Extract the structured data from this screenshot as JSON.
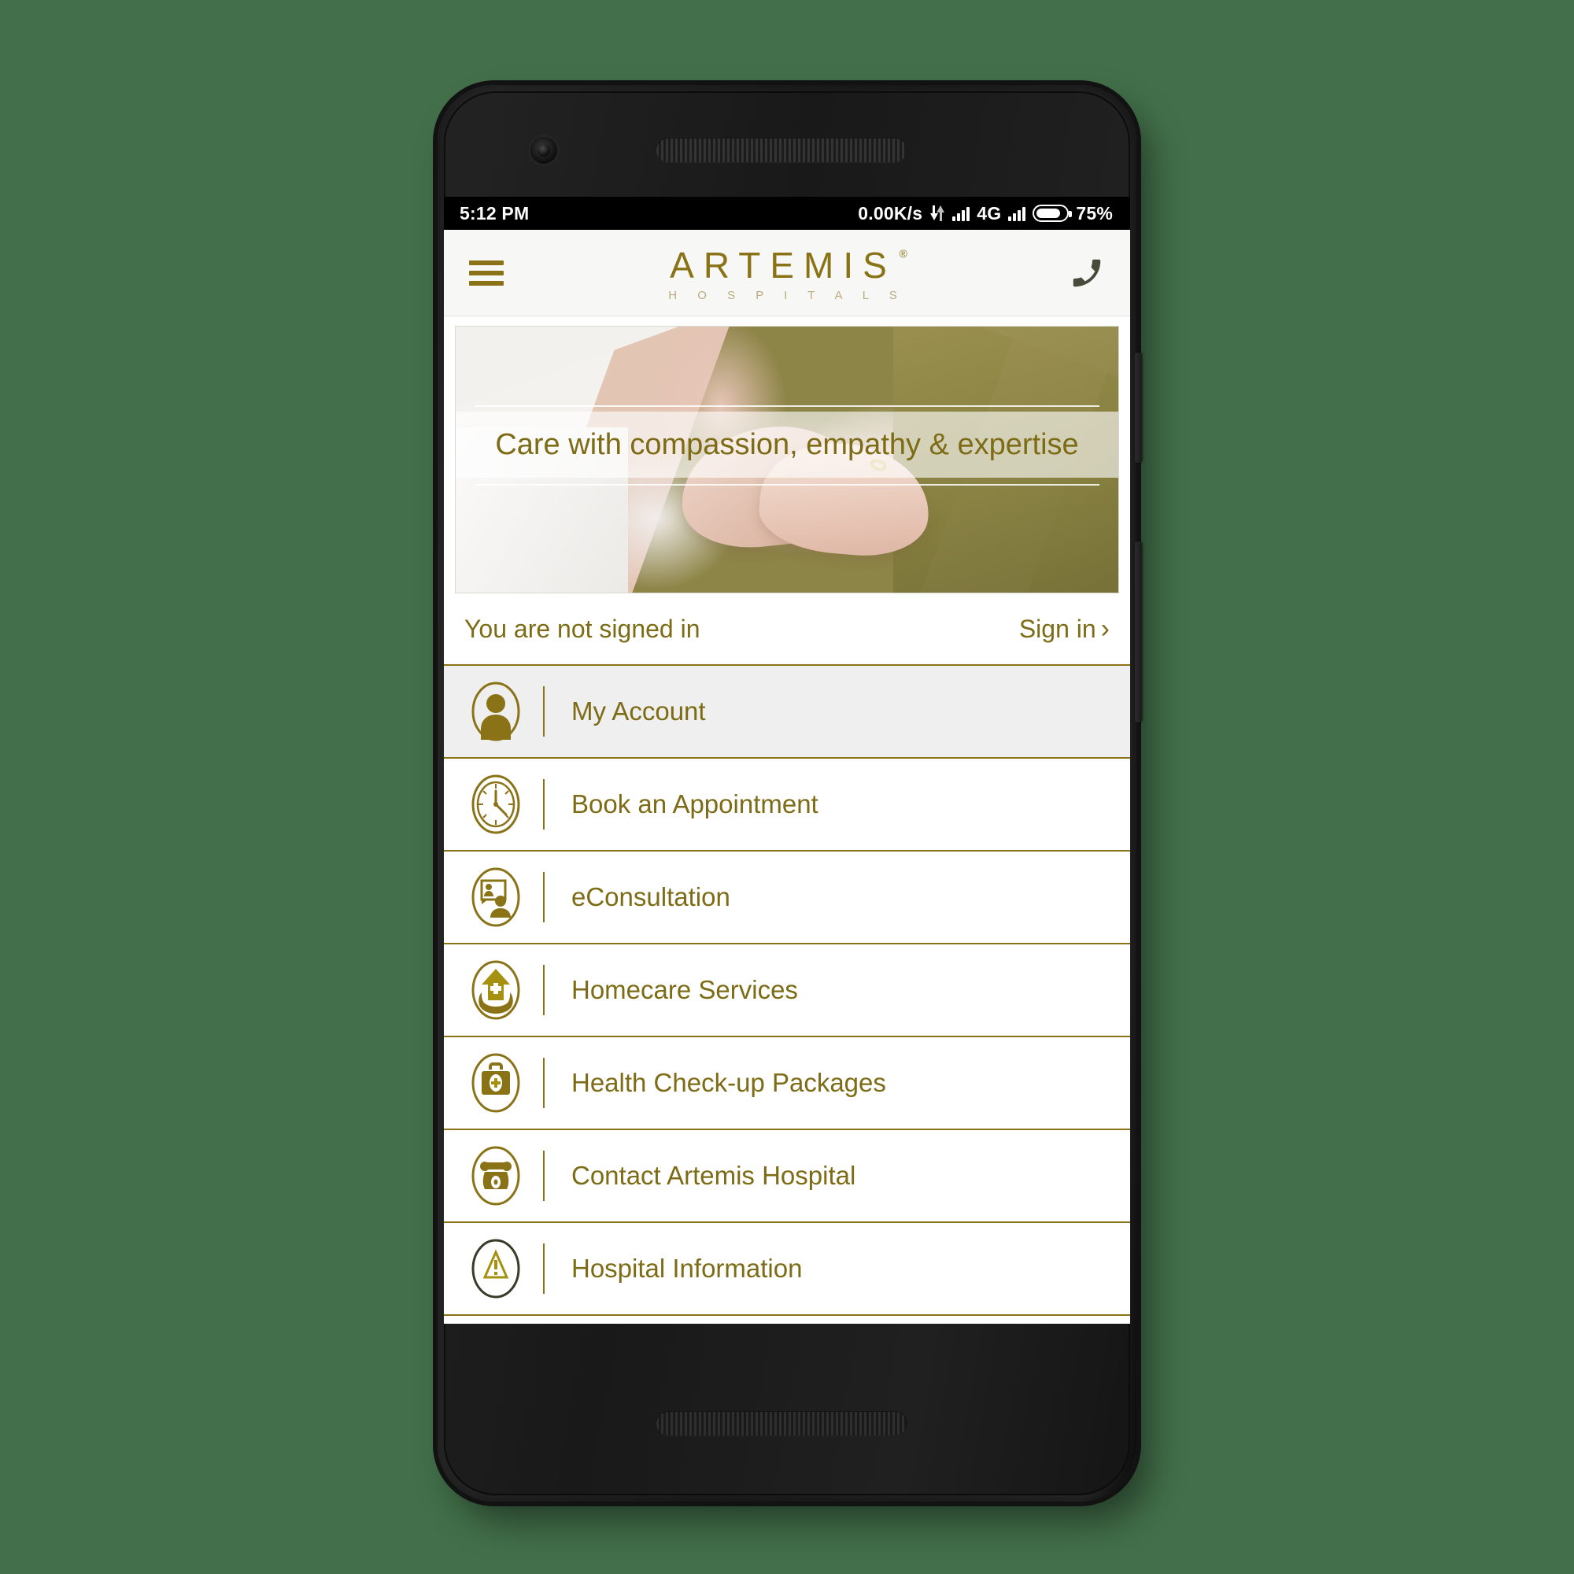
{
  "device": {
    "frame": "android-phone",
    "camera_icon": "front-camera",
    "speaker_icon": "earpiece-speaker"
  },
  "statusbar": {
    "time": "5:12 PM",
    "network_speed": "0.00K/s",
    "transfer_icon": "data-transfer-arrows-icon",
    "signal_icon_1": "signal-bars-icon",
    "network_type": "4G",
    "signal_icon_2": "signal-bars-icon",
    "battery_icon": "battery-icon",
    "battery_percent": "75%"
  },
  "appbar": {
    "menu_icon": "hamburger-menu-icon",
    "logo": "ARTEMIS",
    "logo_tm": "®",
    "logo_sub": "H O S P I T A L S",
    "call_icon": "phone-call-icon"
  },
  "banner": {
    "caption": "Care with compassion, empathy & expertise",
    "image_alt": "hands-together-care-photo"
  },
  "signin": {
    "notice": "You are not signed in",
    "action": "Sign in",
    "chevron_icon": "chevron-right-icon"
  },
  "menu": {
    "items": [
      {
        "label": "My Account",
        "icon": "user-avatar-icon",
        "active": true
      },
      {
        "label": "Book an Appointment",
        "icon": "clock-icon",
        "active": false
      },
      {
        "label": "eConsultation",
        "icon": "video-consultation-icon",
        "active": false
      },
      {
        "label": "Homecare Services",
        "icon": "home-in-hands-icon",
        "active": false
      },
      {
        "label": "Health Check-up Packages",
        "icon": "medical-kit-icon",
        "active": false
      },
      {
        "label": "Contact Artemis Hospital",
        "icon": "telephone-icon",
        "active": false
      },
      {
        "label": "Hospital Information",
        "icon": "info-triangle-icon",
        "active": false
      }
    ]
  },
  "colors": {
    "gold": "#8a7317",
    "gold_text": "#7d6b15",
    "background_green": "#43704a",
    "active_row": "#efefef",
    "appbar_bg": "#f7f7f5"
  }
}
